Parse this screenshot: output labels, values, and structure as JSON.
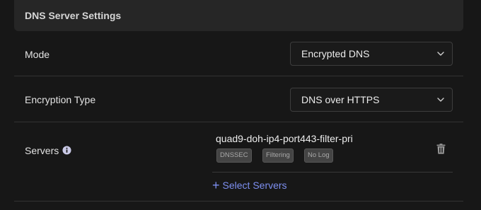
{
  "section": {
    "title": "DNS Server Settings"
  },
  "mode": {
    "label": "Mode",
    "value": "Encrypted DNS"
  },
  "encryption": {
    "label": "Encryption Type",
    "value": "DNS over HTTPS"
  },
  "servers": {
    "label": "Servers",
    "info_icon": "info-circle-icon",
    "items": [
      {
        "name": "quad9-doh-ip4-port443-filter-pri",
        "badges": [
          "DNSSEC",
          "Filtering",
          "No Log"
        ]
      }
    ],
    "select_label": "Select Servers"
  },
  "colors": {
    "background": "#171717",
    "header_bg": "#262626",
    "accent": "#7d8ff0",
    "badge_bg": "#444444"
  }
}
